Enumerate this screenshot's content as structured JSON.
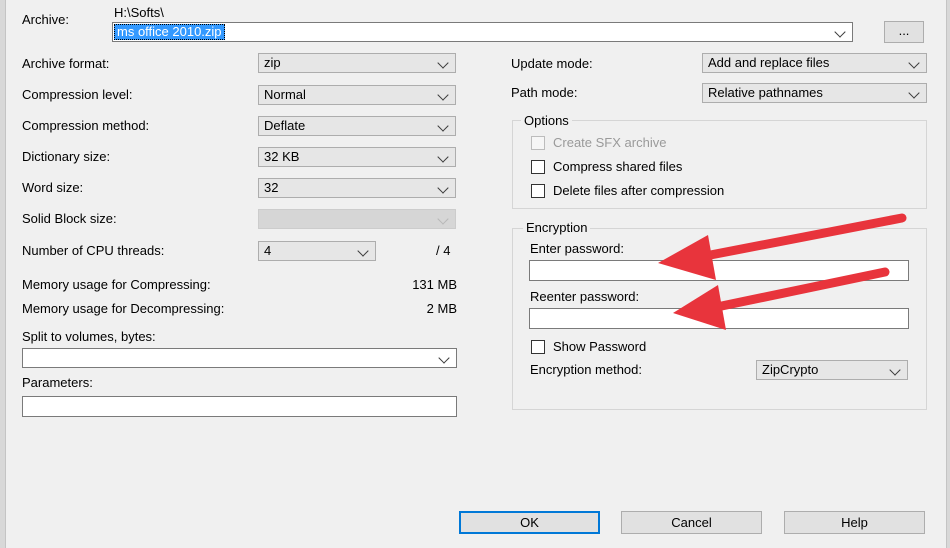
{
  "archive": {
    "label": "Archive:",
    "path": "H:\\Softs\\",
    "filename": "ms office 2010.zip",
    "browse_label": "..."
  },
  "left": {
    "archive_format": {
      "label": "Archive format:",
      "value": "zip"
    },
    "compression_level": {
      "label": "Compression level:",
      "value": "Normal"
    },
    "compression_method": {
      "label": "Compression method:",
      "value": "Deflate"
    },
    "dictionary_size": {
      "label": "Dictionary size:",
      "value": "32 KB"
    },
    "word_size": {
      "label": "Word size:",
      "value": "32"
    },
    "solid_block": {
      "label": "Solid Block size:",
      "value": ""
    },
    "cpu_threads": {
      "label": "Number of CPU threads:",
      "value": "4",
      "max": "/ 4"
    },
    "mem_compress": {
      "label": "Memory usage for Compressing:",
      "value": "131 MB"
    },
    "mem_decompress": {
      "label": "Memory usage for Decompressing:",
      "value": "2 MB"
    },
    "split": {
      "label": "Split to volumes, bytes:",
      "value": ""
    },
    "parameters": {
      "label": "Parameters:",
      "value": ""
    }
  },
  "right": {
    "update_mode": {
      "label": "Update mode:",
      "value": "Add and replace files"
    },
    "path_mode": {
      "label": "Path mode:",
      "value": "Relative pathnames"
    },
    "options": {
      "title": "Options",
      "create_sfx": "Create SFX archive",
      "compress_shared": "Compress shared files",
      "delete_after": "Delete files after compression"
    },
    "encryption": {
      "title": "Encryption",
      "enter_password": "Enter password:",
      "reenter_password": "Reenter password:",
      "show_password": "Show Password",
      "method_label": "Encryption method:",
      "method_value": "ZipCrypto"
    }
  },
  "buttons": {
    "ok": "OK",
    "cancel": "Cancel",
    "help": "Help"
  },
  "colors": {
    "annotation_arrow": "#e8343c",
    "selection": "#3399ff",
    "default_button_border": "#0078d7"
  }
}
